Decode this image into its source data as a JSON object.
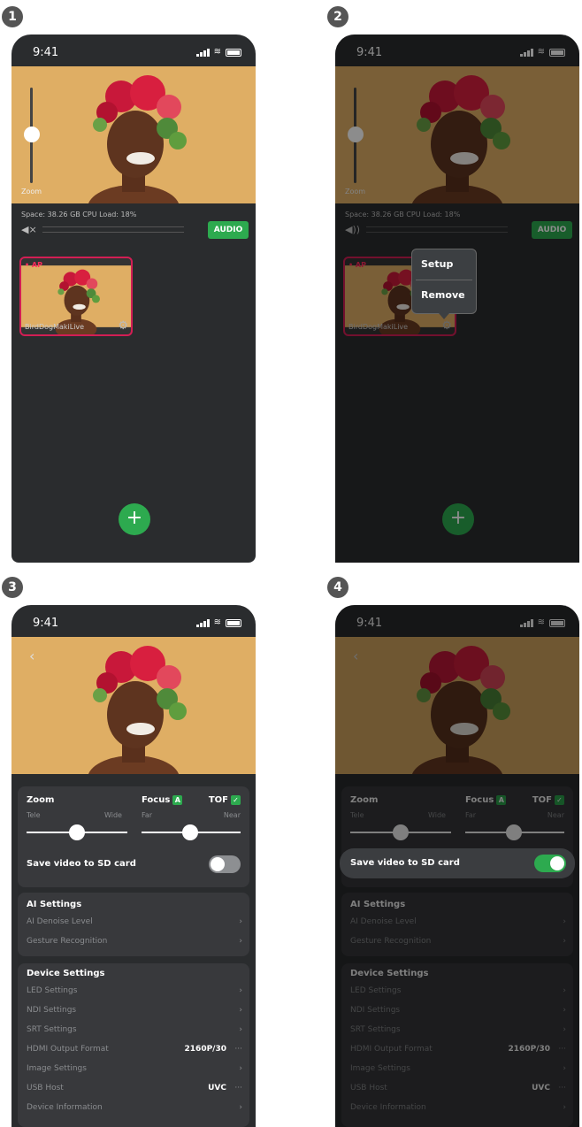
{
  "steps": [
    "1",
    "2",
    "3",
    "4"
  ],
  "status": {
    "time": "9:41"
  },
  "live": {
    "zoom_label": "Zoom",
    "info": "Space: 38.26 GB CPU Load: 18%",
    "mute_icon": "◀×",
    "speaker_icon": "◀))",
    "audio_button": "AUDIO",
    "source_badge": "• AP",
    "source_name": "BirdDogMakiLive",
    "gear_icon": "⚙",
    "add_button": "+"
  },
  "context_menu": {
    "setup": "Setup",
    "remove": "Remove"
  },
  "settings": {
    "back_icon": "‹",
    "zoom_title": "Zoom",
    "tele": "Tele",
    "wide": "Wide",
    "focus_title": "Focus",
    "focus_mode": "A",
    "far": "Far",
    "near": "Near",
    "tof": "TOF",
    "tof_check": "✓",
    "save_sd": "Save video to SD card",
    "save_sd_on_step3": false,
    "save_sd_on_step4": true,
    "ai_title": "AI Settings",
    "ai_denoise": "AI Denoise Level",
    "gesture": "Gesture Recognition",
    "device_title": "Device Settings",
    "led": "LED Settings",
    "ndi": "NDI Settings",
    "srt": "SRT Settings",
    "hdmi": "HDMI Output Format",
    "hdmi_value": "2160P/30",
    "image": "Image Settings",
    "usb": "USB Host",
    "usb_value": "UVC",
    "device_info": "Device Information",
    "chevron": "›",
    "ellipsis": "···"
  },
  "colors": {
    "accent": "#2daa4f",
    "highlight": "#d21e54",
    "bg": "#2a2c2e"
  }
}
